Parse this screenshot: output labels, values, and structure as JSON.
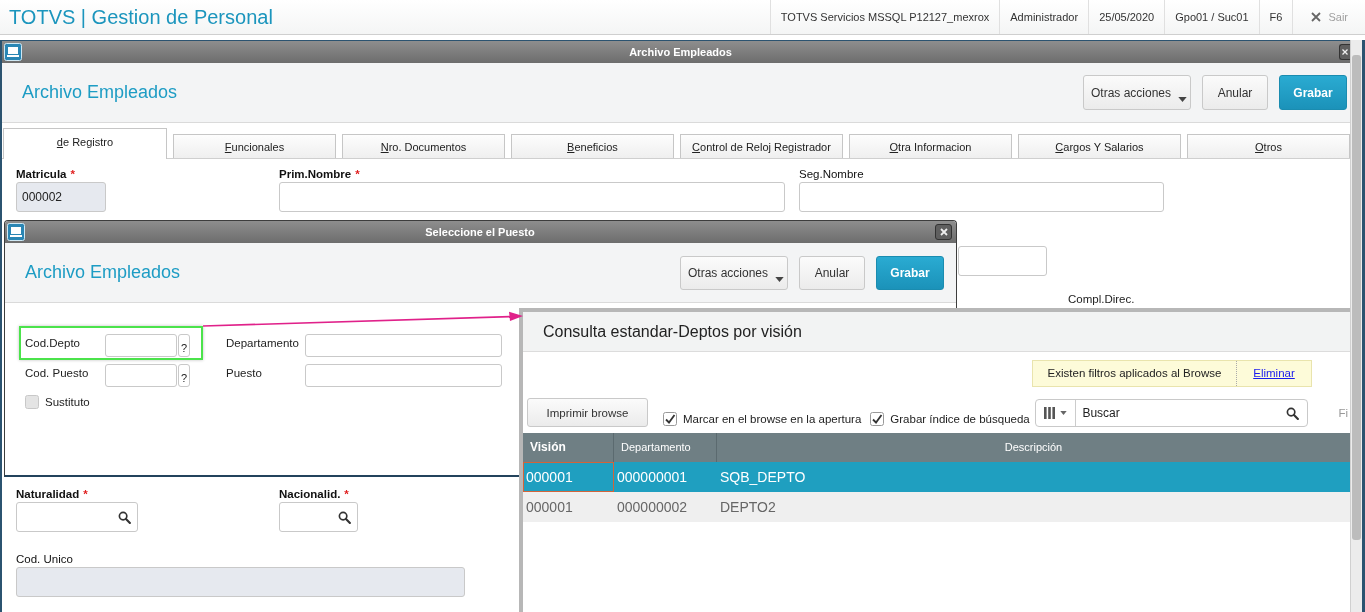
{
  "app_bar": {
    "title": "TOTVS | Gestion de Personal",
    "info": [
      "TOTVS Servicios MSSQL P12127_mexrox",
      "Administrador",
      "25/05/2020",
      "Gpo01 / Suc01",
      "F6"
    ],
    "exit": {
      "label": "Sair",
      "disabled": true
    }
  },
  "window": {
    "title": "Archivo Empleados",
    "heading": "Archivo Empleados",
    "actions": [
      {
        "label": "Otras acciones",
        "kind": "menu"
      },
      {
        "label": "Anular",
        "kind": "secondary"
      },
      {
        "label": "Grabar",
        "kind": "primary"
      }
    ],
    "tabs": [
      {
        "label": "de Registro",
        "selected": true
      },
      {
        "label": "Funcionales",
        "selected": false
      },
      {
        "label": "Nro. Documentos",
        "selected": false
      },
      {
        "label": "Beneficios",
        "selected": false
      },
      {
        "label": "Control de Reloj Registrador",
        "selected": false
      },
      {
        "label": "Otra Informacion",
        "selected": false
      },
      {
        "label": "Cargos Y Salarios",
        "selected": false
      },
      {
        "label": "Otros",
        "selected": false
      }
    ],
    "form": {
      "top_fields": [
        {
          "label": "Matricula",
          "required_mark": "*",
          "kind": "readonly",
          "value": "000002"
        },
        {
          "label": "Prim.Nombre",
          "required_mark": "*",
          "kind": "text"
        },
        {
          "label": "Seg.Nombre",
          "kind": "text"
        }
      ],
      "partial_label": "Compl.Direc.",
      "lower_fields": [
        {
          "label": "Naturalidad",
          "required_mark": "*",
          "kind": "lookup"
        },
        {
          "label": "Nacionalid.",
          "required_mark": "*",
          "kind": "lookup"
        }
      ],
      "bottom_fields": [
        {
          "label": "Cod. Unico",
          "kind": "readonly"
        }
      ]
    }
  },
  "dialog": {
    "title": "Seleccione el Puesto",
    "heading": "Archivo Empleados",
    "actions": [
      {
        "label": "Otras acciones",
        "kind": "menu"
      },
      {
        "label": "Anular",
        "kind": "secondary"
      },
      {
        "label": "Grabar",
        "kind": "primary"
      }
    ],
    "fields": [
      {
        "label": "Cod.Depto",
        "kind": "code",
        "help_label": "?",
        "highlighted": true
      },
      {
        "label": "Departamento",
        "kind": "text",
        "highlighted": false
      },
      {
        "label": "Cod. Puesto",
        "kind": "code",
        "help_label": "?",
        "highlighted": false
      },
      {
        "label": "Puesto",
        "kind": "text",
        "highlighted": false
      }
    ],
    "checkbox": {
      "label": "Sustituto",
      "checked": false,
      "disabled": true
    }
  },
  "lookup": {
    "title": "Consulta estandar-Deptos por visión",
    "notice": {
      "text": "Existen filtros aplicados al Browse",
      "link": "Eliminar"
    },
    "print_button": "Imprimir browse",
    "options": [
      {
        "label": "Marcar en el browse en la apertura",
        "checked": true
      },
      {
        "label": "Grabar índice de búsqueda",
        "checked": true
      }
    ],
    "search": {
      "placeholder": "Buscar"
    },
    "cut_label": "Fi",
    "table": {
      "columns": [
        "Visión",
        "Departamento",
        "Descripción"
      ],
      "rows": [
        {
          "cells": [
            "000001",
            "000000001",
            "SQB_DEPTO"
          ],
          "selected": true,
          "focused": true
        },
        {
          "cells": [
            "000001",
            "000000002",
            "DEPTO2"
          ],
          "selected": false,
          "focused": false
        }
      ]
    }
  }
}
